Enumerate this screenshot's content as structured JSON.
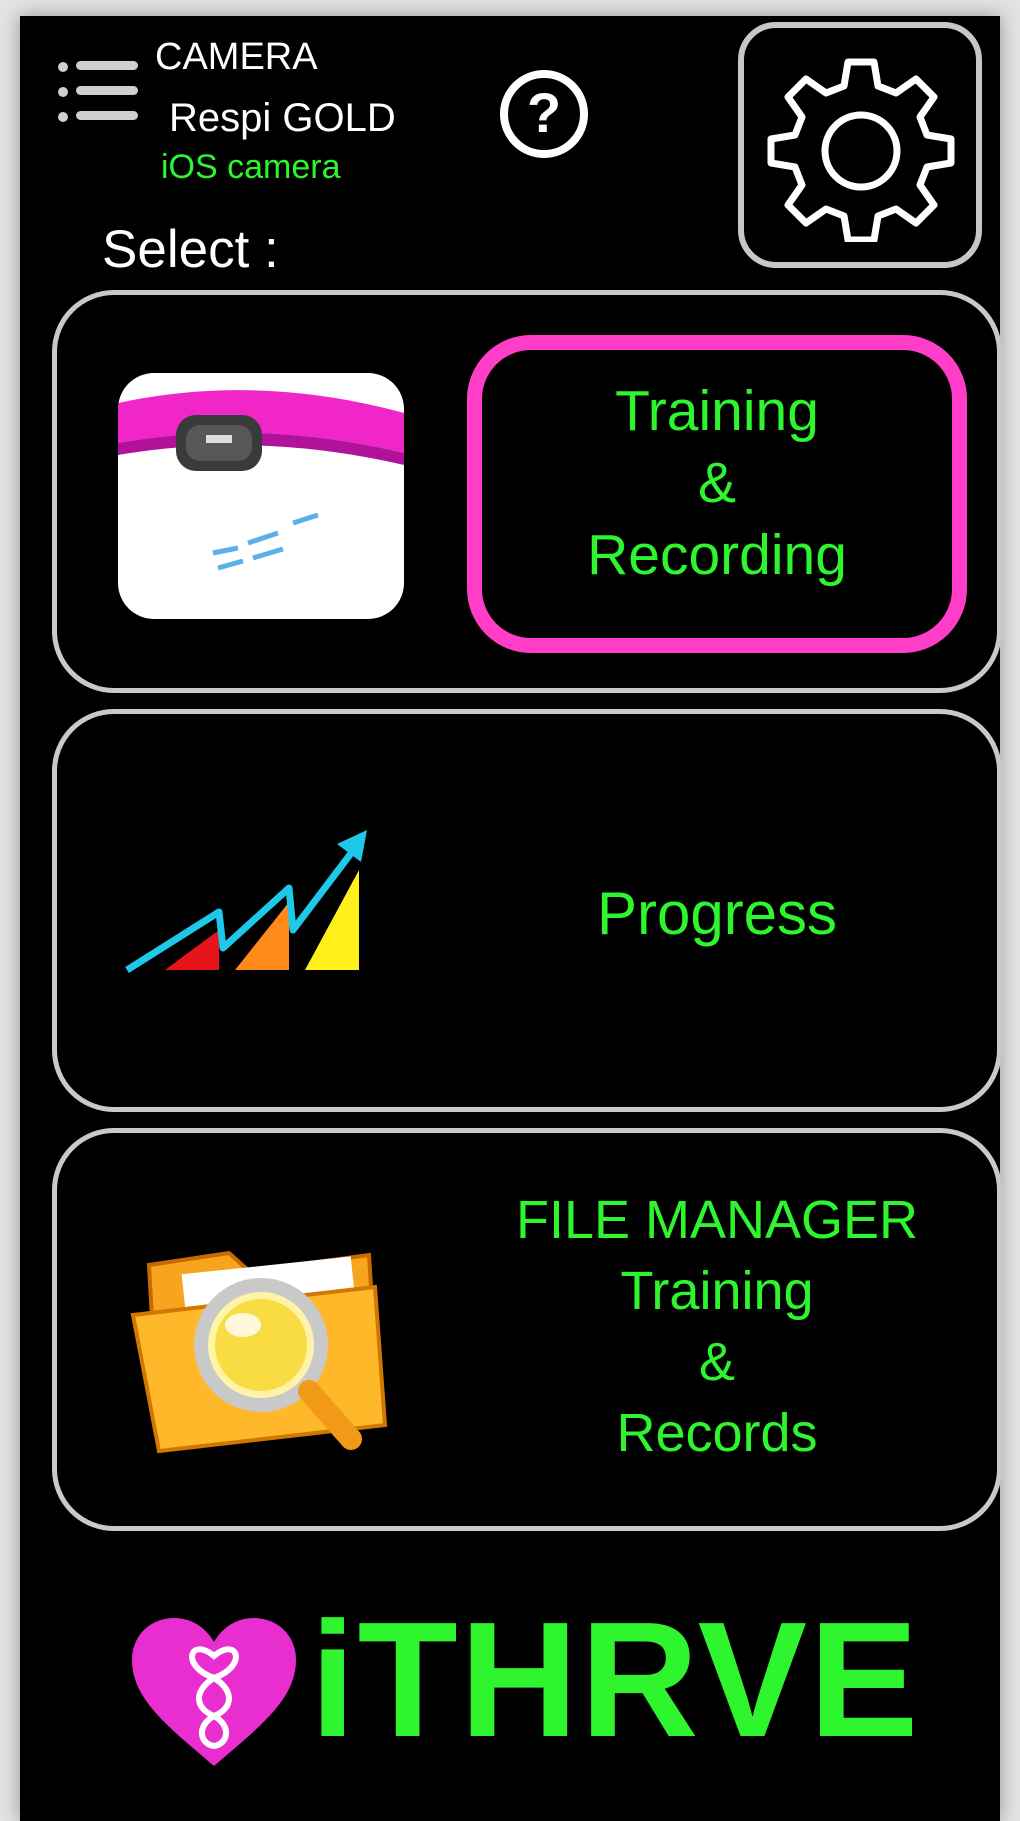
{
  "header": {
    "mode_camera": "CAMERA",
    "mode_product": "Respi GOLD",
    "mode_source": "iOS camera",
    "help_symbol": "?"
  },
  "select_label": "Select :",
  "cards": [
    {
      "label": "Training\n&\nRecording",
      "icon": "heart-rate-strap-icon",
      "highlighted": true
    },
    {
      "label": "Progress",
      "icon": "progress-chart-icon",
      "highlighted": false
    },
    {
      "label": "FILE MANAGER\nTraining\n&\nRecords",
      "icon": "folder-search-icon",
      "highlighted": false
    }
  ],
  "brand": {
    "name": "iTHRVE",
    "logo": "heart-logo-icon"
  },
  "colors": {
    "background": "#000000",
    "label_green": "#2ef52e",
    "highlight_magenta": "#ff3dc8",
    "card_border": "#c9c9c9"
  }
}
